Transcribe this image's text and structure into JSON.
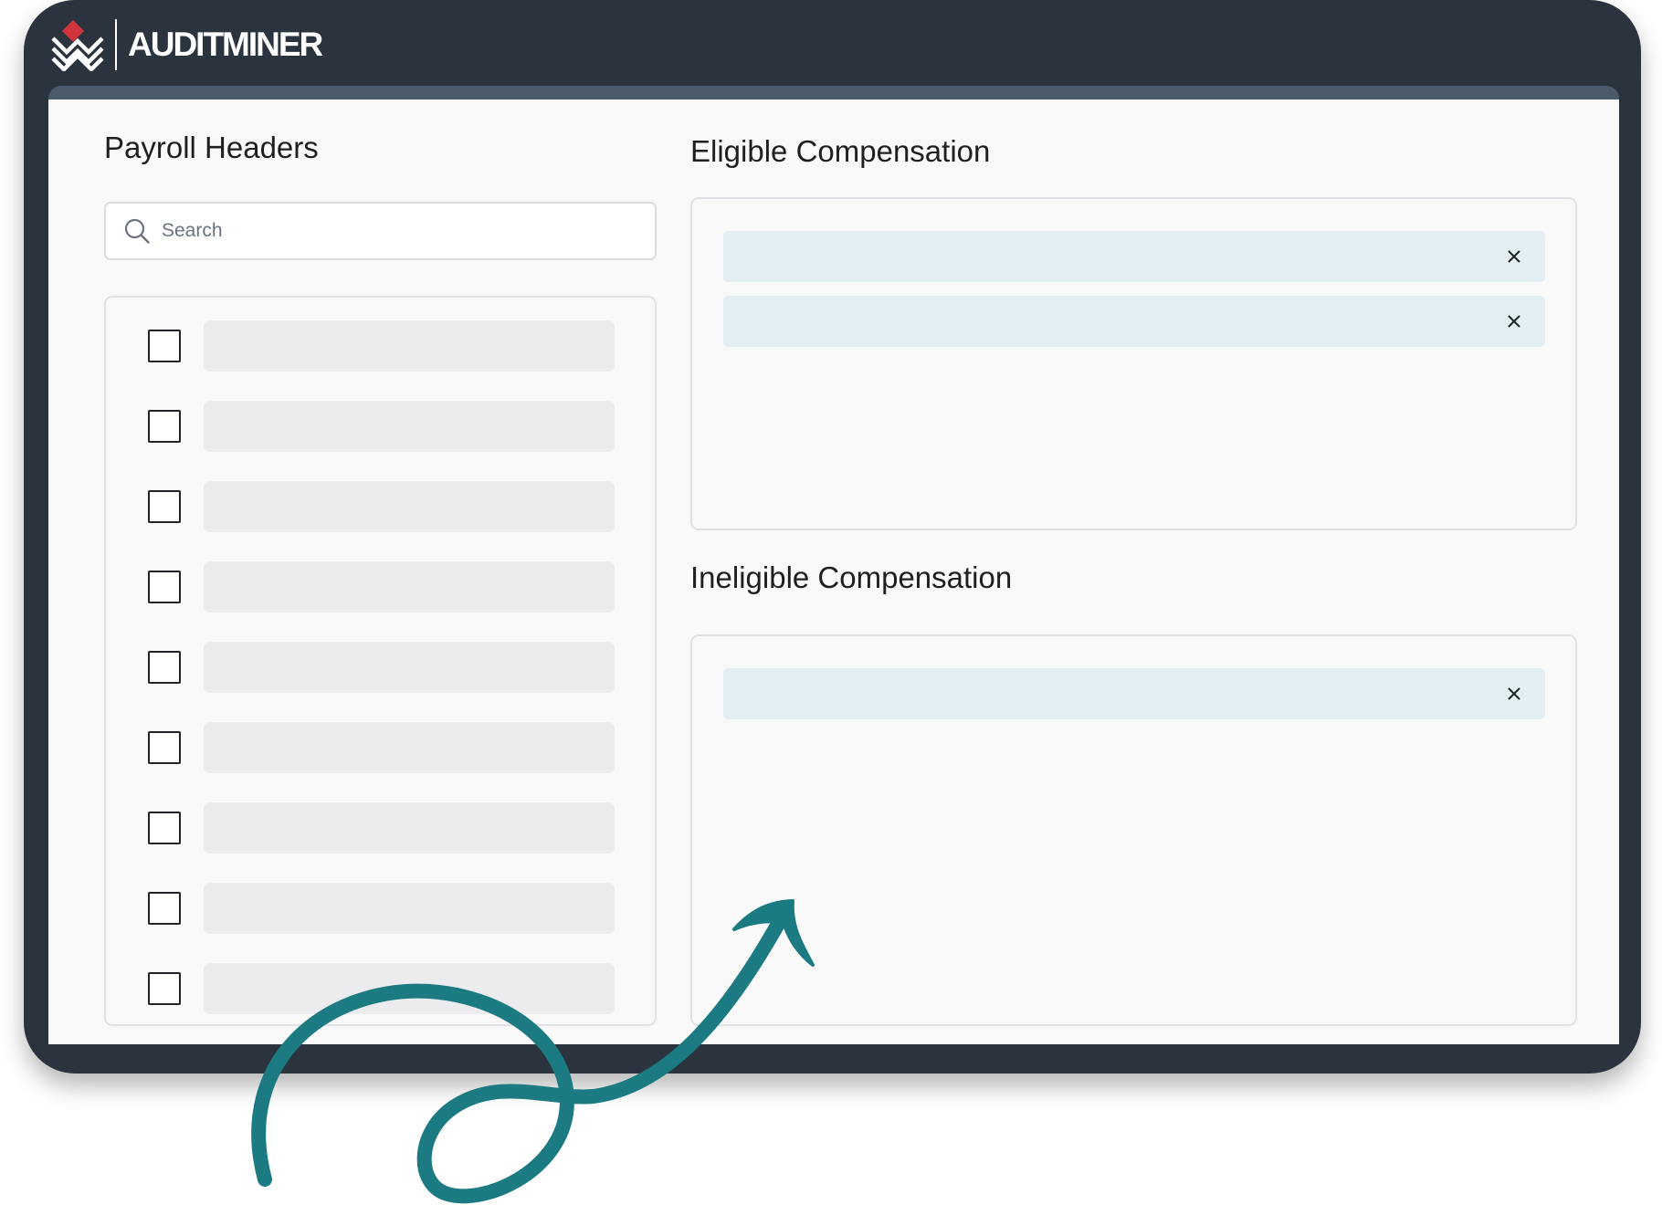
{
  "brand": {
    "name": "AUDITMINER",
    "logo_icon": "auditminer-mountain-logo-icon"
  },
  "colors": {
    "device_bezel": "#2b343e",
    "screen_frame": "#4b5a6b",
    "screen_bg": "#f9f9f9",
    "chip_bg": "#e2eef2",
    "placeholder_bar": "#ececee",
    "accent_arrow": "#1b7a82",
    "logo_red": "#d0343b"
  },
  "payroll_headers": {
    "title": "Payroll Headers",
    "search": {
      "placeholder": "Search",
      "value": "",
      "icon": "search-icon"
    },
    "rows": [
      {
        "checked": false
      },
      {
        "checked": false
      },
      {
        "checked": false
      },
      {
        "checked": false
      },
      {
        "checked": false
      },
      {
        "checked": false
      },
      {
        "checked": false
      },
      {
        "checked": false
      },
      {
        "checked": false
      }
    ]
  },
  "eligible": {
    "title": "Eligible Compensation",
    "chip_count": 2,
    "remove_icon": "close-icon"
  },
  "ineligible": {
    "title": "Ineligible Compensation",
    "chip_count": 1,
    "remove_icon": "close-icon"
  },
  "decoration": {
    "arrow_icon": "curly-arrow-icon"
  }
}
